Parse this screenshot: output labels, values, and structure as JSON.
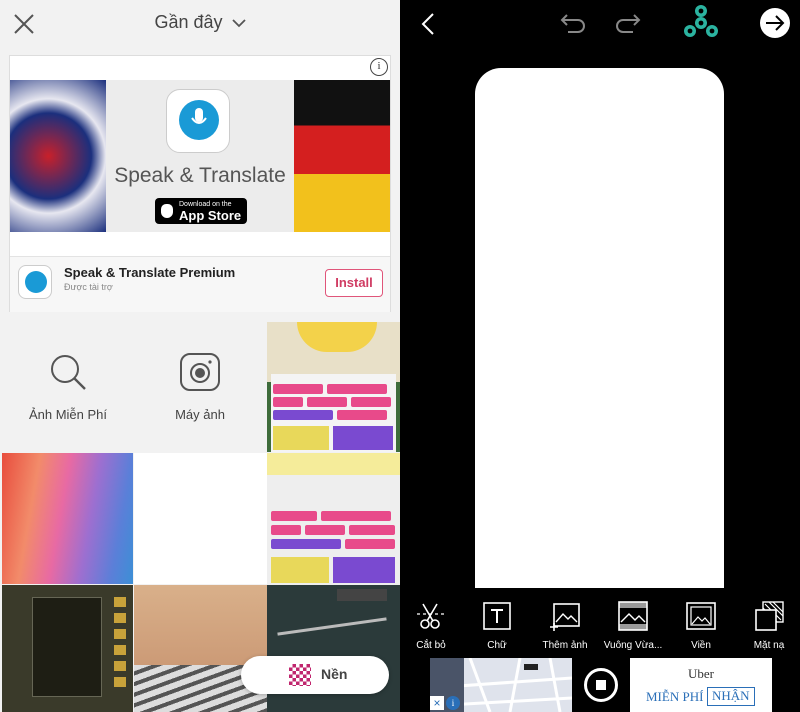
{
  "left_panel": {
    "header": {
      "title": "Gần đây",
      "close_icon": "close-icon",
      "chevron_icon": "chevron-down-icon"
    },
    "ad": {
      "app_title": "Speak & Translate",
      "store_badge_small": "Download on the",
      "store_badge_large": "App Store",
      "app_name": "Speak & Translate Premium",
      "sponsored": "Được tài trợ",
      "install_label": "Install",
      "info_icon": "i"
    },
    "actions": [
      {
        "label": "Ảnh Miễn Phí",
        "icon": "search-icon"
      },
      {
        "label": "Máy ảnh",
        "icon": "camera-icon"
      }
    ],
    "background_button": {
      "label": "Nền",
      "icon": "checkerboard-icon"
    }
  },
  "right_panel": {
    "toolbar": {
      "back_icon": "back-chevron-icon",
      "undo_icon": "undo-icon",
      "redo_icon": "redo-icon",
      "spinner_icon": "fidget-spinner-icon",
      "next_icon": "next-arrow-icon"
    },
    "tools": [
      {
        "label": "Cắt bỏ",
        "icon": "cutout-icon"
      },
      {
        "label": "Chữ",
        "icon": "text-icon"
      },
      {
        "label": "Thêm ảnh",
        "icon": "add-photo-icon"
      },
      {
        "label": "Vuông Vừa...",
        "icon": "square-fit-icon"
      },
      {
        "label": "Viền",
        "icon": "border-icon"
      },
      {
        "label": "Mặt nạ",
        "icon": "mask-icon"
      }
    ],
    "banner_ad": {
      "brand": "Uber",
      "free_text": "MIỄN PHÍ",
      "cta": "NHẬN",
      "close_icon": "×",
      "info_icon": "i"
    }
  },
  "colors": {
    "accent_pink": "#d03c63",
    "ad_blue": "#2a6fb8",
    "spinner_teal": "#2bb3a0"
  }
}
